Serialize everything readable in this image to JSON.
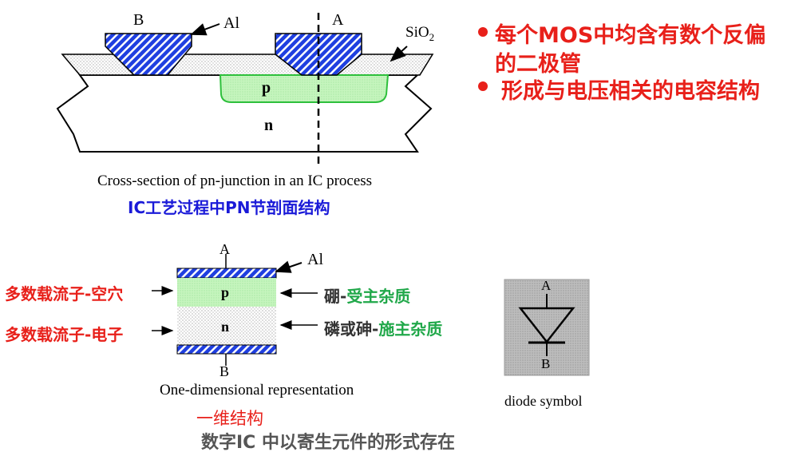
{
  "bullets": [
    {
      "text_line1": "每个MOS中均含有数个反偏",
      "text_line2": "的二极管"
    },
    {
      "text_line1": "形成与电压相关的电容结构"
    }
  ],
  "cross_section": {
    "label_B": "B",
    "label_A": "A",
    "label_Al": "Al",
    "label_SiO2": "SiO",
    "label_SiO2_sub": "2",
    "label_p": "p",
    "label_n": "n",
    "caption_en": "Cross-section of pn-junction in an IC process",
    "caption_cn": "IC工艺过程中PN节剖面结构"
  },
  "one_dim": {
    "label_A": "A",
    "label_B": "B",
    "label_Al": "Al",
    "label_p": "p",
    "label_n": "n",
    "left_majority_holes": "多数载流子-空穴",
    "left_majority_electrons": "多数载流子-电子",
    "right_boron_a": "硼-",
    "right_boron_b": "受主杂质",
    "right_phos_a": "磷或砷-",
    "right_phos_b": "施主杂质",
    "caption_en": "One-dimensional  representation",
    "caption_cn": "一维结构"
  },
  "diode": {
    "label_A": "A",
    "label_B": "B",
    "caption": "diode symbol"
  },
  "footer": "数字IC 中以寄生元件的形式存在",
  "colors": {
    "red": "#e8201a",
    "blue": "#1a1ad8",
    "green": "#21a84a",
    "metal_blue": "#1f3fe0",
    "p_green": "#b8f0b0",
    "footer_gray": "#555555"
  }
}
